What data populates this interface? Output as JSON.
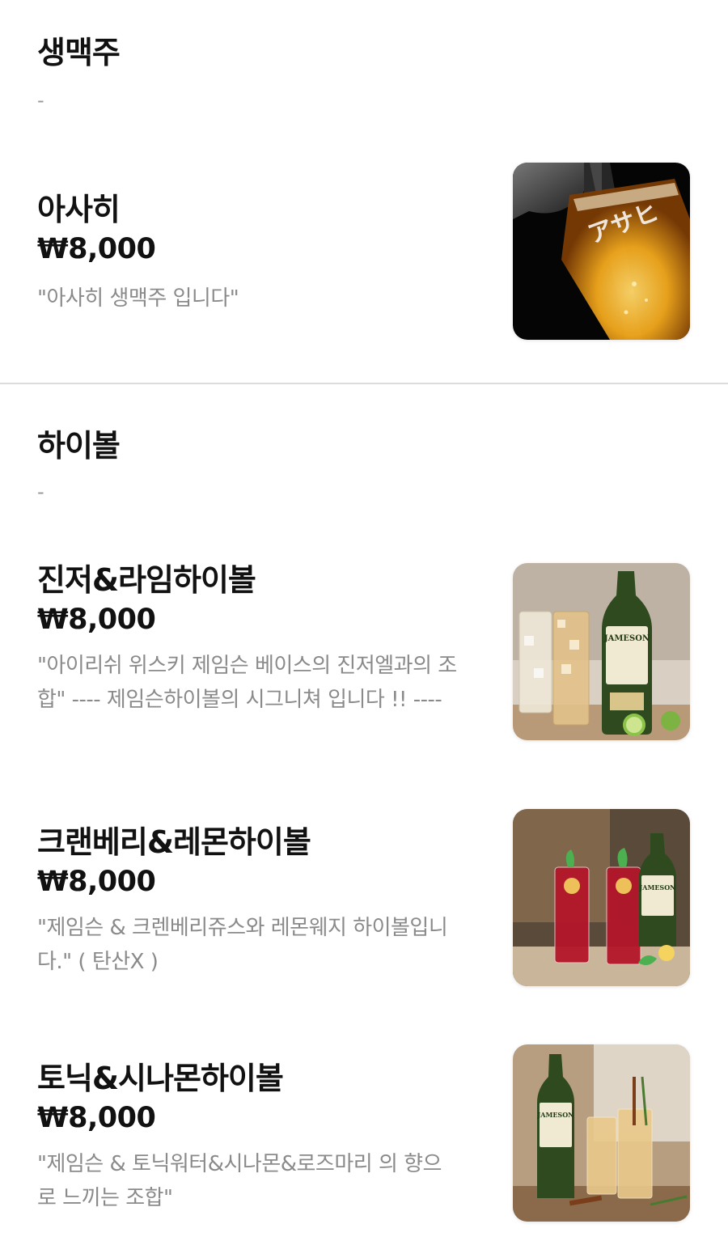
{
  "sections": [
    {
      "title": "생맥주",
      "subtitle": "-",
      "items": [
        {
          "name": "아사히",
          "price": "₩8,000",
          "description": "\"아사히 생맥주 입니다\"",
          "image_icon": "beer-glass-photo"
        }
      ]
    },
    {
      "title": "하이볼",
      "subtitle": "-",
      "items": [
        {
          "name": "진저&라임하이볼",
          "price": "₩8,000",
          "description": "\"아이리쉬 위스키 제임슨 베이스의 진저엘과의 조합\"  ---- 제임슨하이볼의 시그니쳐 입니다 !! ----",
          "image_icon": "ginger-highball-photo",
          "bottle_label": "JAMESON"
        },
        {
          "name": "크랜베리&레몬하이볼",
          "price": "₩8,000",
          "description": "\"제임슨 & 크렌베리쥬스와 레몬웨지 하이볼입니다.\"  ( 탄산X )",
          "image_icon": "cranberry-highball-photo",
          "bottle_label": "JAMESON"
        },
        {
          "name": "토닉&시나몬하이볼",
          "price": "₩8,000",
          "description": "\"제임슨 & 토닉워터&시나몬&로즈마리 의 향으로 느끼는 조합\"",
          "image_icon": "tonic-highball-photo",
          "bottle_label": "JAMESON"
        }
      ]
    }
  ],
  "colors": {
    "title": "#111111",
    "description": "#8a8a8a",
    "divider": "#dcdcdc",
    "bottle_green": "#2f4a1e",
    "beer_gold": "#f2a81c",
    "cranberry": "#b3162a"
  }
}
